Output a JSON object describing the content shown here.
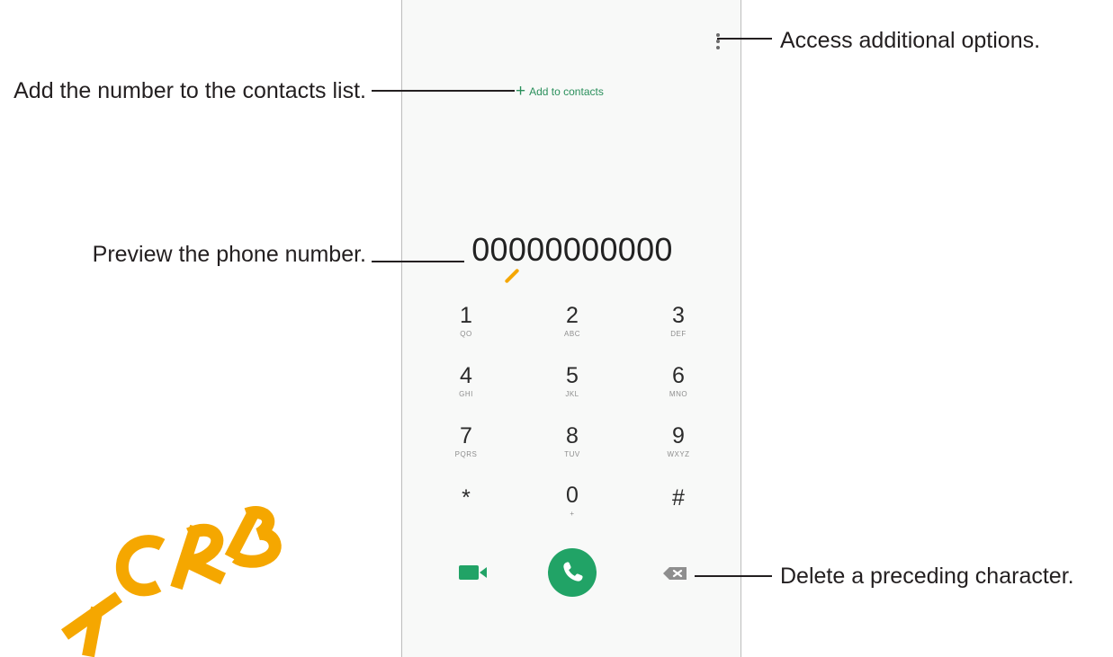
{
  "dialer": {
    "add_to_contacts": {
      "icon": "plus-icon",
      "label": "Add to contacts"
    },
    "more_options_icon": "more-vertical-icon",
    "number_preview": "00000000000",
    "keypad": [
      {
        "digit": "1",
        "letters": "QO"
      },
      {
        "digit": "2",
        "letters": "ABC"
      },
      {
        "digit": "3",
        "letters": "DEF"
      },
      {
        "digit": "4",
        "letters": "GHI"
      },
      {
        "digit": "5",
        "letters": "JKL"
      },
      {
        "digit": "6",
        "letters": "MNO"
      },
      {
        "digit": "7",
        "letters": "PQRS"
      },
      {
        "digit": "8",
        "letters": "TUV"
      },
      {
        "digit": "9",
        "letters": "WXYZ"
      },
      {
        "digit": "*",
        "letters": ""
      },
      {
        "digit": "0",
        "letters": "+"
      },
      {
        "digit": "#",
        "letters": ""
      }
    ],
    "actions": {
      "video": "video-call-icon",
      "call": "phone-icon",
      "delete": "backspace-icon"
    }
  },
  "callouts": {
    "more_options": "Access additional options.",
    "add_contacts": "Add the number to the contacts list.",
    "preview": "Preview the phone number.",
    "delete": "Delete a preceding character."
  },
  "watermark": "TCRB",
  "colors": {
    "accent_green": "#21a366",
    "highlight_orange": "#f5a700",
    "text": "#231f20"
  }
}
